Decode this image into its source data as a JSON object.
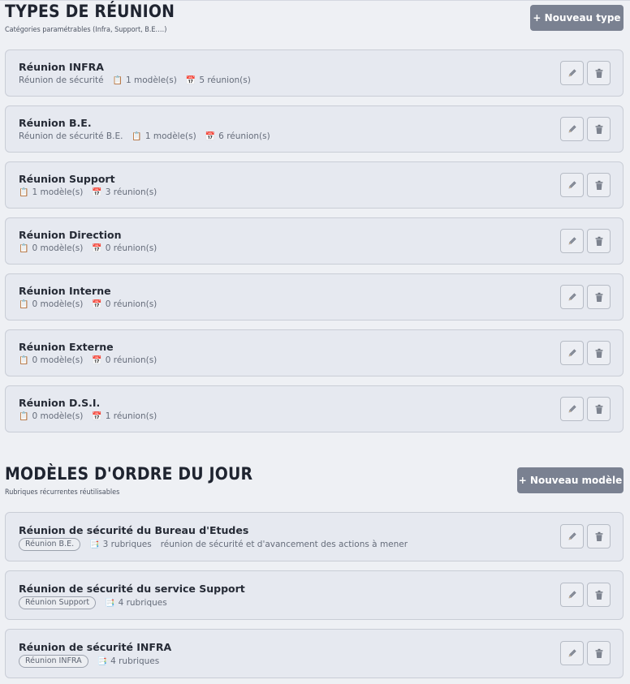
{
  "types_section": {
    "title": "Types de réunion",
    "subtitle": "Catégories paramétrables (Infra, Support, B.E.…)",
    "new_button": "+ Nouveau type"
  },
  "meeting_types": [
    {
      "name": "Réunion INFRA",
      "description": "Réunion de sécurité",
      "models": "1 modèle(s)",
      "meetings": "5 réunion(s)"
    },
    {
      "name": "Réunion B.E.",
      "description": "Réunion de sécurité B.E.",
      "models": "1 modèle(s)",
      "meetings": "6 réunion(s)"
    },
    {
      "name": "Réunion Support",
      "description": "",
      "models": "1 modèle(s)",
      "meetings": "3 réunion(s)"
    },
    {
      "name": "Réunion Direction",
      "description": "",
      "models": "0 modèle(s)",
      "meetings": "0 réunion(s)"
    },
    {
      "name": "Réunion Interne",
      "description": "",
      "models": "0 modèle(s)",
      "meetings": "0 réunion(s)"
    },
    {
      "name": "Réunion Externe",
      "description": "",
      "models": "0 modèle(s)",
      "meetings": "0 réunion(s)"
    },
    {
      "name": "Réunion D.S.I.",
      "description": "",
      "models": "0 modèle(s)",
      "meetings": "1 réunion(s)"
    }
  ],
  "models_section": {
    "title": "Modèles d'ordre du jour",
    "subtitle": "Rubriques récurrentes réutilisables",
    "new_button": "+ Nouveau modèle"
  },
  "agenda_models": [
    {
      "name": "Réunion de sécurité du Bureau d'Etudes",
      "type_badge": "Réunion B.E.",
      "rubrics": "3 rubriques",
      "description": "réunion de sécurité et d'avancement des actions à mener"
    },
    {
      "name": "Réunion de sécurité du service Support",
      "type_badge": "Réunion Support",
      "rubrics": "4 rubriques",
      "description": ""
    },
    {
      "name": "Réunion de sécurité INFRA",
      "type_badge": "Réunion INFRA",
      "rubrics": "4 rubriques",
      "description": ""
    }
  ],
  "icons": {
    "models": "clipboard-icon",
    "meetings": "calendar-icon",
    "rubrics": "document-icon",
    "edit": "pencil-icon",
    "delete": "trash-icon"
  },
  "glyphs": {
    "models": "📋",
    "meetings": "📅",
    "rubrics": "📑"
  },
  "colors": {
    "background": "#eef0f4",
    "card": "#e6e9f0",
    "primary_button": "#7a8191",
    "calendar_accent": "#d9453a",
    "clipboard_accent": "#c9853a"
  }
}
